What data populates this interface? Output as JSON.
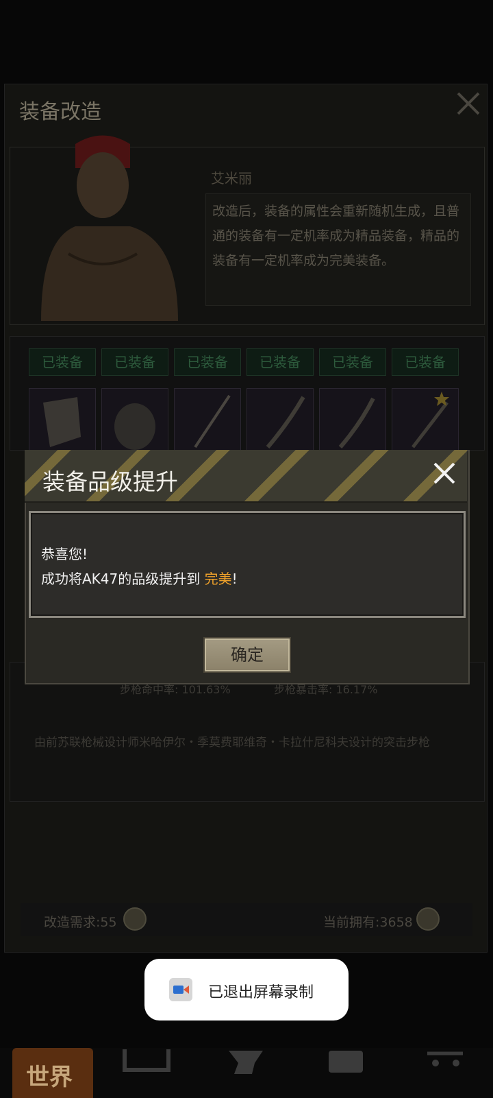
{
  "background": {
    "title": "装备改造",
    "npc": {
      "name": "艾米丽",
      "text": "改造后，装备的属性会重新随机生成，且普通的装备有一定机率成为精品装备，精品的装备有一定机率成为完美装备。"
    },
    "slots": [
      {
        "tag": "已装备"
      },
      {
        "tag": "已装备"
      },
      {
        "tag": "已装备"
      },
      {
        "tag": "已装备"
      },
      {
        "tag": "已装备"
      },
      {
        "tag": "已装备"
      }
    ],
    "stats": {
      "left": "步枪命中率: 101.63%",
      "right": "步枪暴击率: 16.17%"
    },
    "description": "由前苏联枪械设计师米哈伊尔・季莫费耶维奇・卡拉什尼科夫设计的突击步枪",
    "requirement": "改造需求:55",
    "owned": "当前拥有:3658"
  },
  "modal": {
    "title": "装备品级提升",
    "line1": "恭喜您!",
    "line2_prefix": "成功将AK47的品级提升到 ",
    "line2_highlight": "完美",
    "line2_suffix": "!",
    "confirm_label": "确定",
    "highlight_color": "#f0a22a"
  },
  "toast": {
    "text": "已退出屏幕录制"
  },
  "nav": {
    "world_label": "世界"
  }
}
